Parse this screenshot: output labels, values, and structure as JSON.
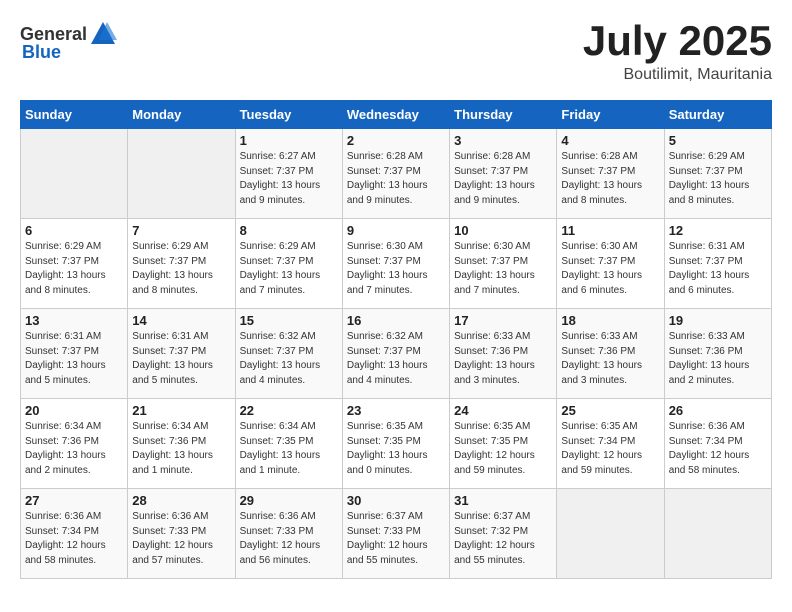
{
  "header": {
    "logo_general": "General",
    "logo_blue": "Blue",
    "month": "July 2025",
    "location": "Boutilimit, Mauritania"
  },
  "weekdays": [
    "Sunday",
    "Monday",
    "Tuesday",
    "Wednesday",
    "Thursday",
    "Friday",
    "Saturday"
  ],
  "weeks": [
    [
      {
        "day": "",
        "info": ""
      },
      {
        "day": "",
        "info": ""
      },
      {
        "day": "1",
        "info": "Sunrise: 6:27 AM\nSunset: 7:37 PM\nDaylight: 13 hours and 9 minutes."
      },
      {
        "day": "2",
        "info": "Sunrise: 6:28 AM\nSunset: 7:37 PM\nDaylight: 13 hours and 9 minutes."
      },
      {
        "day": "3",
        "info": "Sunrise: 6:28 AM\nSunset: 7:37 PM\nDaylight: 13 hours and 9 minutes."
      },
      {
        "day": "4",
        "info": "Sunrise: 6:28 AM\nSunset: 7:37 PM\nDaylight: 13 hours and 8 minutes."
      },
      {
        "day": "5",
        "info": "Sunrise: 6:29 AM\nSunset: 7:37 PM\nDaylight: 13 hours and 8 minutes."
      }
    ],
    [
      {
        "day": "6",
        "info": "Sunrise: 6:29 AM\nSunset: 7:37 PM\nDaylight: 13 hours and 8 minutes."
      },
      {
        "day": "7",
        "info": "Sunrise: 6:29 AM\nSunset: 7:37 PM\nDaylight: 13 hours and 8 minutes."
      },
      {
        "day": "8",
        "info": "Sunrise: 6:29 AM\nSunset: 7:37 PM\nDaylight: 13 hours and 7 minutes."
      },
      {
        "day": "9",
        "info": "Sunrise: 6:30 AM\nSunset: 7:37 PM\nDaylight: 13 hours and 7 minutes."
      },
      {
        "day": "10",
        "info": "Sunrise: 6:30 AM\nSunset: 7:37 PM\nDaylight: 13 hours and 7 minutes."
      },
      {
        "day": "11",
        "info": "Sunrise: 6:30 AM\nSunset: 7:37 PM\nDaylight: 13 hours and 6 minutes."
      },
      {
        "day": "12",
        "info": "Sunrise: 6:31 AM\nSunset: 7:37 PM\nDaylight: 13 hours and 6 minutes."
      }
    ],
    [
      {
        "day": "13",
        "info": "Sunrise: 6:31 AM\nSunset: 7:37 PM\nDaylight: 13 hours and 5 minutes."
      },
      {
        "day": "14",
        "info": "Sunrise: 6:31 AM\nSunset: 7:37 PM\nDaylight: 13 hours and 5 minutes."
      },
      {
        "day": "15",
        "info": "Sunrise: 6:32 AM\nSunset: 7:37 PM\nDaylight: 13 hours and 4 minutes."
      },
      {
        "day": "16",
        "info": "Sunrise: 6:32 AM\nSunset: 7:37 PM\nDaylight: 13 hours and 4 minutes."
      },
      {
        "day": "17",
        "info": "Sunrise: 6:33 AM\nSunset: 7:36 PM\nDaylight: 13 hours and 3 minutes."
      },
      {
        "day": "18",
        "info": "Sunrise: 6:33 AM\nSunset: 7:36 PM\nDaylight: 13 hours and 3 minutes."
      },
      {
        "day": "19",
        "info": "Sunrise: 6:33 AM\nSunset: 7:36 PM\nDaylight: 13 hours and 2 minutes."
      }
    ],
    [
      {
        "day": "20",
        "info": "Sunrise: 6:34 AM\nSunset: 7:36 PM\nDaylight: 13 hours and 2 minutes."
      },
      {
        "day": "21",
        "info": "Sunrise: 6:34 AM\nSunset: 7:36 PM\nDaylight: 13 hours and 1 minute."
      },
      {
        "day": "22",
        "info": "Sunrise: 6:34 AM\nSunset: 7:35 PM\nDaylight: 13 hours and 1 minute."
      },
      {
        "day": "23",
        "info": "Sunrise: 6:35 AM\nSunset: 7:35 PM\nDaylight: 13 hours and 0 minutes."
      },
      {
        "day": "24",
        "info": "Sunrise: 6:35 AM\nSunset: 7:35 PM\nDaylight: 12 hours and 59 minutes."
      },
      {
        "day": "25",
        "info": "Sunrise: 6:35 AM\nSunset: 7:34 PM\nDaylight: 12 hours and 59 minutes."
      },
      {
        "day": "26",
        "info": "Sunrise: 6:36 AM\nSunset: 7:34 PM\nDaylight: 12 hours and 58 minutes."
      }
    ],
    [
      {
        "day": "27",
        "info": "Sunrise: 6:36 AM\nSunset: 7:34 PM\nDaylight: 12 hours and 58 minutes."
      },
      {
        "day": "28",
        "info": "Sunrise: 6:36 AM\nSunset: 7:33 PM\nDaylight: 12 hours and 57 minutes."
      },
      {
        "day": "29",
        "info": "Sunrise: 6:36 AM\nSunset: 7:33 PM\nDaylight: 12 hours and 56 minutes."
      },
      {
        "day": "30",
        "info": "Sunrise: 6:37 AM\nSunset: 7:33 PM\nDaylight: 12 hours and 55 minutes."
      },
      {
        "day": "31",
        "info": "Sunrise: 6:37 AM\nSunset: 7:32 PM\nDaylight: 12 hours and 55 minutes."
      },
      {
        "day": "",
        "info": ""
      },
      {
        "day": "",
        "info": ""
      }
    ]
  ]
}
